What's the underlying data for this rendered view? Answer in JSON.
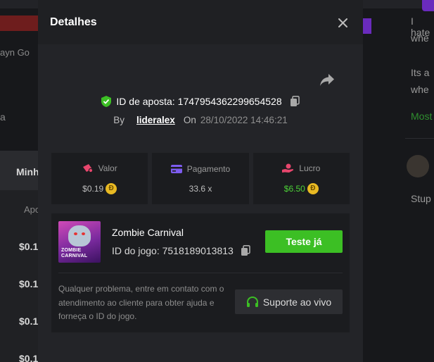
{
  "background": {
    "left_text_1": "ayn Go",
    "left_text_2": "a",
    "left_tab": "Minh",
    "left_col": "Apo",
    "left_values": [
      "$0.1",
      "$0.1",
      "$0.1",
      "$0.1"
    ],
    "right_lines": [
      "I hate",
      "whe",
      "Its a",
      "whe"
    ],
    "right_green": "Most",
    "right_reply": "Stup"
  },
  "modal": {
    "title": "Detalhes",
    "bet_id_label": "ID de aposta:",
    "bet_id": "1747954362299654528",
    "by_label": "By",
    "username": "lideralex",
    "on_label": "On",
    "date": "28/10/2022 14:46:21"
  },
  "stats": [
    {
      "label": "Valor",
      "value": "$0.19",
      "coin": true,
      "color": "#bdbdbd"
    },
    {
      "label": "Pagamento",
      "value": "33.6 x",
      "coin": false,
      "color": "#bdbdbd"
    },
    {
      "label": "Lucro",
      "value": "$6.50",
      "coin": true,
      "color": "#4cd137"
    }
  ],
  "game": {
    "name": "Zombie Carnival",
    "thumb_text": "ZOMBIE CARNIVAL",
    "id_label": "ID do jogo:",
    "id": "7518189013813",
    "try_label": "Teste já",
    "help_text": "Qualquer problema, entre em contato com o atendimento ao cliente para obter ajuda e forneça o ID do jogo.",
    "support_label": "Suporte ao vivo"
  },
  "colors": {
    "accent_green": "#3cbf24",
    "profit_green": "#4cd137",
    "coin": "#e8b923",
    "shield_green": "#3cbf24",
    "valor_icon": "#e8466d",
    "pagamento_icon": "#7d5cf0",
    "lucro_icon": "#e8466d"
  }
}
